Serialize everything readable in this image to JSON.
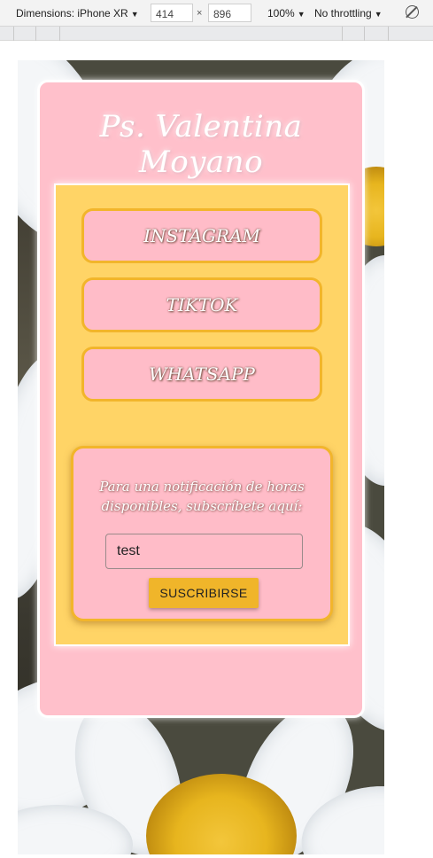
{
  "devtools": {
    "device_label": "Dimensions: iPhone XR",
    "width": "414",
    "height": "896",
    "times": "×",
    "zoom": "100%",
    "throttling": "No throttling",
    "caret": "▼"
  },
  "page": {
    "title": "Ps. Valentina Moyano",
    "links": [
      {
        "label": "INSTAGRAM"
      },
      {
        "label": "TIKTOK"
      },
      {
        "label": "WHATSAPP"
      }
    ],
    "subscribe": {
      "text": "Para una notificación de horas disponibles, subscríbete aquí:",
      "input_value": "test",
      "button_label": "SUSCRIBIRSE"
    }
  },
  "colors": {
    "card_pink": "#ffc0cb",
    "panel_yellow": "#ffd466",
    "accent_gold": "#f2b52b"
  }
}
